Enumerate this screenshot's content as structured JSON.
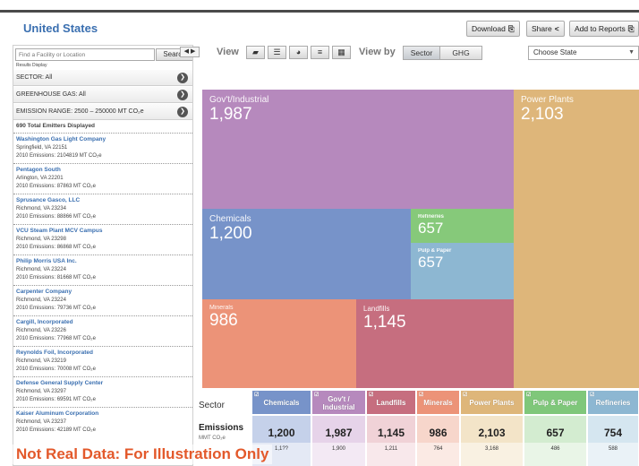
{
  "header": {
    "title": "United States",
    "download_label": "Download",
    "share_label": "Share",
    "add_to_reports_label": "Add to Reports"
  },
  "sidebar": {
    "search_placeholder": "Find a Facility or Location",
    "search_button": "Search",
    "results_display": "Results Display",
    "filters": [
      {
        "label": "SECTOR: All"
      },
      {
        "label": "GREENHOUSE GAS: All"
      },
      {
        "label": "EMISSION RANGE: 2500 – 250000 MT CO₂e"
      }
    ],
    "total_label": "690 Total Emitters Displayed",
    "facilities": [
      {
        "name": "Washington Gas Light Company",
        "address": "Springfield, VA 22151",
        "emissions": "2010 Emissions: 2104819 MT CO₂e"
      },
      {
        "name": "Pentagon South",
        "address": "Arlington, VA 22201",
        "emissions": "2010 Emissions: 87863 MT CO₂e"
      },
      {
        "name": "Sprusance Gasco, LLC",
        "address": "Richmond, VA 23234",
        "emissions": "2010 Emissions: 88866 MT CO₂e"
      },
      {
        "name": "VCU Steam Plant MCV Campus",
        "address": "Richmond, VA 23298",
        "emissions": "2010 Emissions: 86868 MT CO₂e"
      },
      {
        "name": "Philip Morris USA Inc.",
        "address": "Richmond, VA 23224",
        "emissions": "2010 Emissions: 81668 MT CO₂e"
      },
      {
        "name": "Carpenter Company",
        "address": "Richmond, VA 23224",
        "emissions": "2010 Emissions: 79736 MT CO₂e"
      },
      {
        "name": "Cargill, Incorporated",
        "address": "Richmond, VA 23226",
        "emissions": "2010 Emissions: 77968 MT CO₂e"
      },
      {
        "name": "Reynolds Foil, Incorporated",
        "address": "Richmond, VA 23219",
        "emissions": "2010 Emissions: 70008 MT CO₂e"
      },
      {
        "name": "Defense General Supply Center",
        "address": "Richmond, VA 23297",
        "emissions": "2010 Emissions: 69591 MT CO₂e"
      },
      {
        "name": "Kaiser Aluminum Corporation",
        "address": "Richmond, VA 23237",
        "emissions": "2010 Emissions: 42189 MT CO₂e"
      }
    ]
  },
  "view": {
    "view_label": "View",
    "icons": [
      "map-icon",
      "list-icon",
      "pie-icon",
      "bar-icon",
      "tree-icon"
    ],
    "view_by_label": "View by",
    "sector_button": "Sector",
    "ghg_button": "GHG",
    "state_select": "Choose State",
    "pager": "◀ ▶"
  },
  "treemap": {
    "tiles": [
      {
        "label": "Gov't/Industrial",
        "value": "1,987",
        "color": "#b689bd"
      },
      {
        "label": "Power Plants",
        "value": "2,103",
        "color": "#deb67a"
      },
      {
        "label": "Chemicals",
        "value": "1,200",
        "color": "#7793c9"
      },
      {
        "label": "Refineries",
        "value": "657",
        "color": "#86c97a"
      },
      {
        "label": "Pulp & Paper",
        "value": "657",
        "color": "#8db7d2"
      },
      {
        "label": "Minerals",
        "value": "986",
        "color": "#ec9378"
      },
      {
        "label": "Landfills",
        "value": "1,145",
        "color": "#c66e7f"
      }
    ]
  },
  "table": {
    "sector_label": "Sector",
    "emissions_label": "Emissions",
    "emissions_unit": "MMT CO₂e",
    "columns": [
      {
        "name": "Chemicals",
        "value": "1,200",
        "value2": "1,1??",
        "color": "#7793c9",
        "bg": "#c5d1ea"
      },
      {
        "name": "Gov't / Industrial",
        "value": "1,987",
        "value2": "1,900",
        "color": "#b689bd",
        "bg": "#e6d3e9"
      },
      {
        "name": "Landfills",
        "value": "1,145",
        "value2": "1,211",
        "color": "#c66e7f",
        "bg": "#f0d2d7"
      },
      {
        "name": "Minerals",
        "value": "986",
        "value2": "764",
        "color": "#ec9378",
        "bg": "#f7d6cb"
      },
      {
        "name": "Power Plants",
        "value": "2,103",
        "value2": "3,168",
        "color": "#deb67a",
        "bg": "#f3e4c8"
      },
      {
        "name": "Pulp & Paper",
        "value": "657",
        "value2": "486",
        "color": "#7fc77a",
        "bg": "#d3ecd0"
      },
      {
        "name": "Refineries",
        "value": "754",
        "value2": "588",
        "color": "#8db7d2",
        "bg": "#d5e6f0"
      }
    ]
  },
  "disclaimer": "Not Real Data: For Illustration Only"
}
